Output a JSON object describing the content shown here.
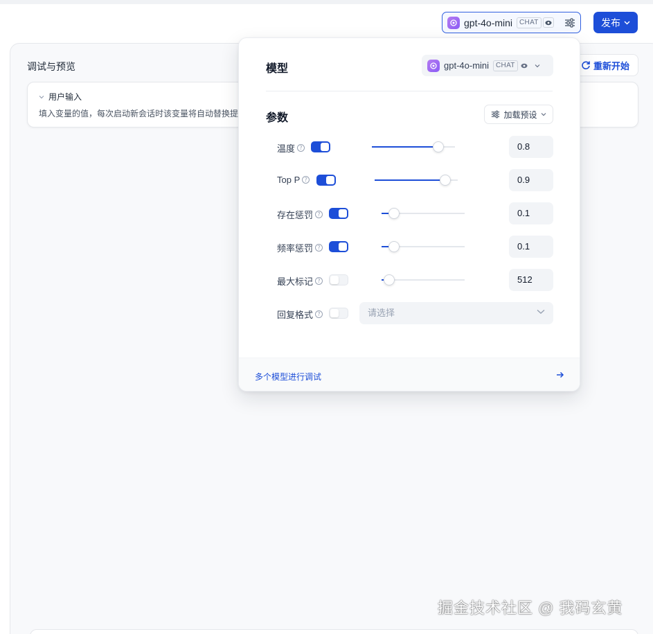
{
  "toolbar": {
    "model_name": "gpt-4o-mini",
    "model_tag": "CHAT",
    "publish_label": "发布"
  },
  "debug_panel": {
    "title": "调试与预览",
    "restart_label": "重新开始",
    "user_input": {
      "header": "用户输入",
      "description": "填入变量的值，每次启动新会话时该变量将自动替换提示词中的内容。"
    }
  },
  "popover": {
    "model_section_title": "模型",
    "model_name": "gpt-4o-mini",
    "model_tag": "CHAT",
    "params_section_title": "参数",
    "preset_label": "加载预设",
    "params": [
      {
        "label": "温度",
        "enabled": true,
        "value": "0.8",
        "level": 0.8
      },
      {
        "label": "Top P",
        "enabled": true,
        "value": "0.9",
        "level": 0.9
      },
      {
        "label": "存在惩罚",
        "enabled": true,
        "value": "0.1",
        "level": 0.1
      },
      {
        "label": "频率惩罚",
        "enabled": true,
        "value": "0.1",
        "level": 0.1
      },
      {
        "label": "最大标记",
        "enabled": false,
        "value": "512",
        "level": 0.05
      }
    ],
    "response_format": {
      "label": "回复格式",
      "enabled": false,
      "placeholder": "请选择"
    },
    "footer_link": "多个模型进行调试"
  },
  "colors": {
    "primary": "#1d4ed8",
    "logo": "#a370f0"
  },
  "icons": [
    "openai-logo-icon",
    "eye-icon",
    "tune-settings-icon",
    "chevron-down-icon",
    "refresh-icon",
    "help-circle-icon",
    "arrow-right-icon"
  ],
  "watermark": "掘金技术社区 @ 我码玄黄"
}
